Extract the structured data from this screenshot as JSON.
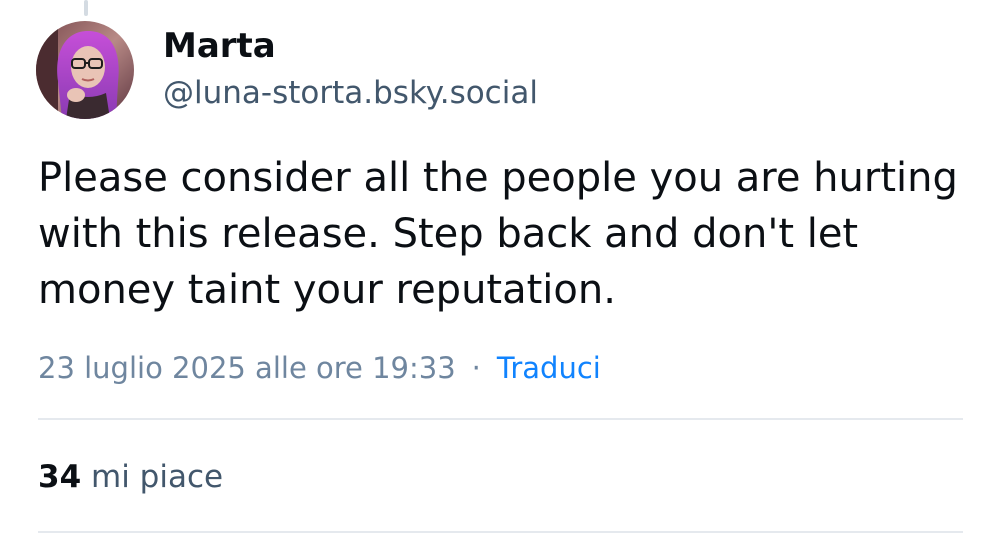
{
  "colors": {
    "text_primary": "#0b0f14",
    "text_secondary": "#42576c",
    "meta_text": "#6f869f",
    "link_accent": "#1083fe",
    "divider": "#e5e9ee",
    "thread_line": "#d4dbe2"
  },
  "post": {
    "author": {
      "display_name": "Marta",
      "handle": "@luna-storta.bsky.social",
      "avatar_icon": "user-avatar-photo"
    },
    "text": "Please consider all the people you are hurting with this release. Step back and don't let money taint your reputation.",
    "timestamp": "23 luglio 2025 alle ore 19:33",
    "separator": "·",
    "translate_label": "Traduci",
    "likes": {
      "count": "34",
      "label": "mi piace"
    }
  }
}
